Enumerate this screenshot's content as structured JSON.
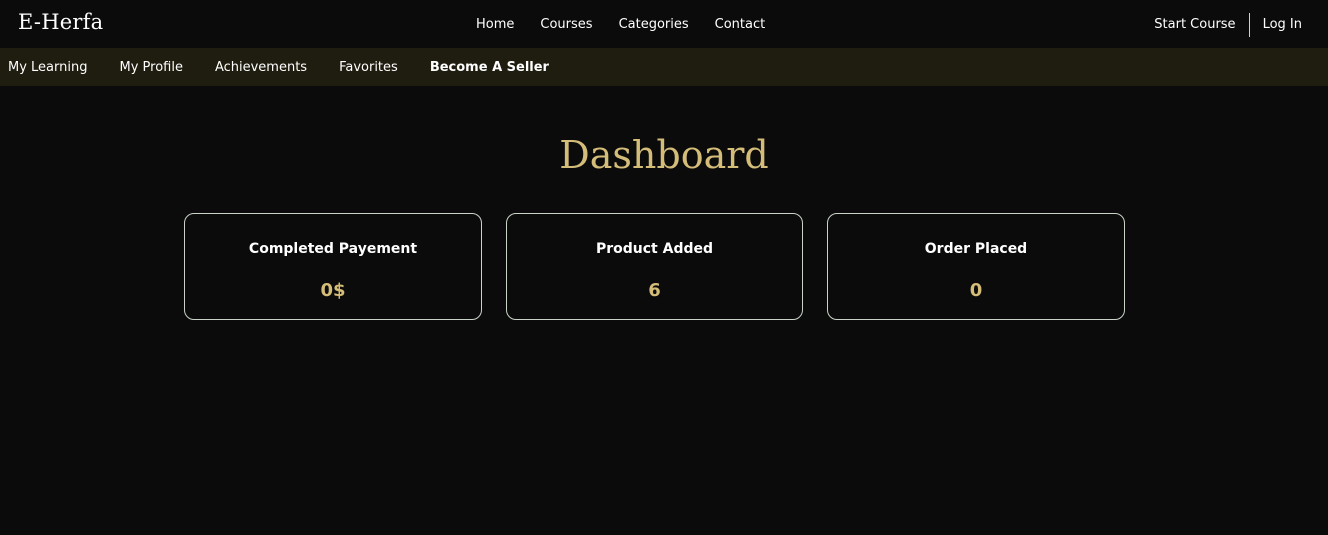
{
  "brand": {
    "logo": "E-Herfa"
  },
  "main_nav": [
    {
      "label": "Home"
    },
    {
      "label": "Courses"
    },
    {
      "label": "Categories"
    },
    {
      "label": "Contact"
    }
  ],
  "auth": {
    "start_course": "Start Course",
    "login": "Log In"
  },
  "subnav": [
    {
      "label": "My Learning"
    },
    {
      "label": "My Profile"
    },
    {
      "label": "Achievements"
    },
    {
      "label": "Favorites"
    },
    {
      "label": "Become A Seller"
    }
  ],
  "page": {
    "title": "Dashboard"
  },
  "stats": [
    {
      "label": "Completed Payement",
      "value": "0$"
    },
    {
      "label": "Product Added",
      "value": "6"
    },
    {
      "label": "Order Placed",
      "value": "0"
    }
  ],
  "colors": {
    "background": "#0b0b0b",
    "subnav_background": "#1f1c10",
    "accent_gold": "#d4bd78",
    "card_border": "#c9d3c8"
  }
}
